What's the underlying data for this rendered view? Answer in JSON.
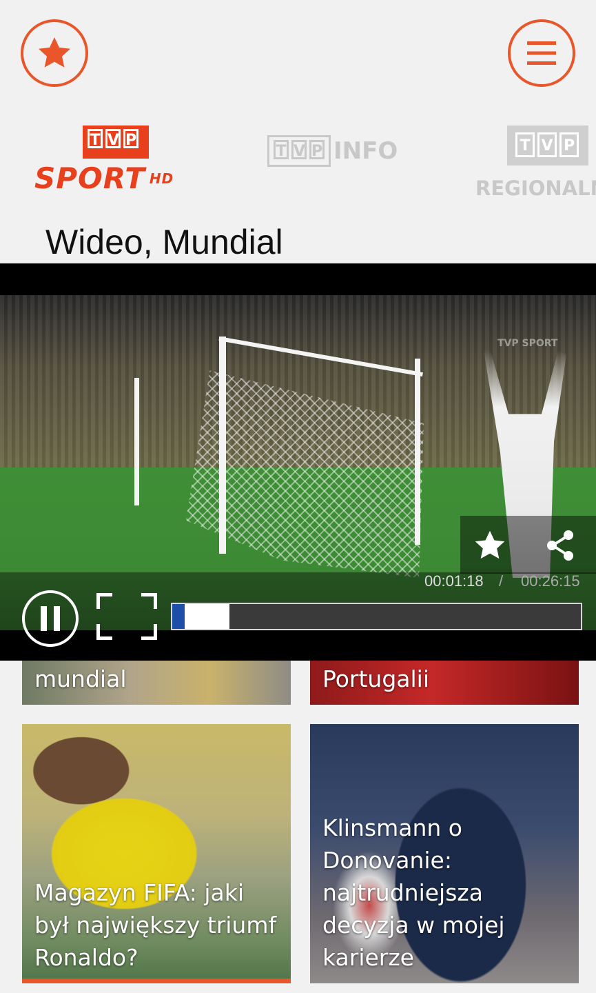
{
  "header": {
    "favorites_icon": "star-icon",
    "menu_icon": "hamburger-menu-icon",
    "accent_color": "#e8562a"
  },
  "channels": [
    {
      "logo_text": "TVP",
      "name": "SPORT",
      "suffix": "HD",
      "active": true
    },
    {
      "logo_text": "TVP",
      "name": "INFO",
      "active": false
    },
    {
      "logo_text": "TVP",
      "name": "REGIONALN",
      "active": false
    }
  ],
  "section_title": "Wideo, Mundial",
  "player": {
    "time_current": "00:01:18",
    "time_separator": "/",
    "time_total": "00:26:15",
    "played_fraction": 0.03,
    "buffered_fraction": 0.14,
    "overlay_logo": "TVP SPORT",
    "progress_color": "#1d4fa8",
    "actions": [
      "star-icon",
      "share-icon",
      "pause-icon",
      "fullscreen-icon"
    ]
  },
  "tiles": [
    {
      "title": "mundial"
    },
    {
      "title": "Portugalii"
    },
    {
      "title": "Magazyn FIFA: jaki był największy triumf Ronaldo?"
    },
    {
      "title": "Klinsmann o Donovanie: najtrudniejsza decyzja w mojej karierze"
    }
  ]
}
